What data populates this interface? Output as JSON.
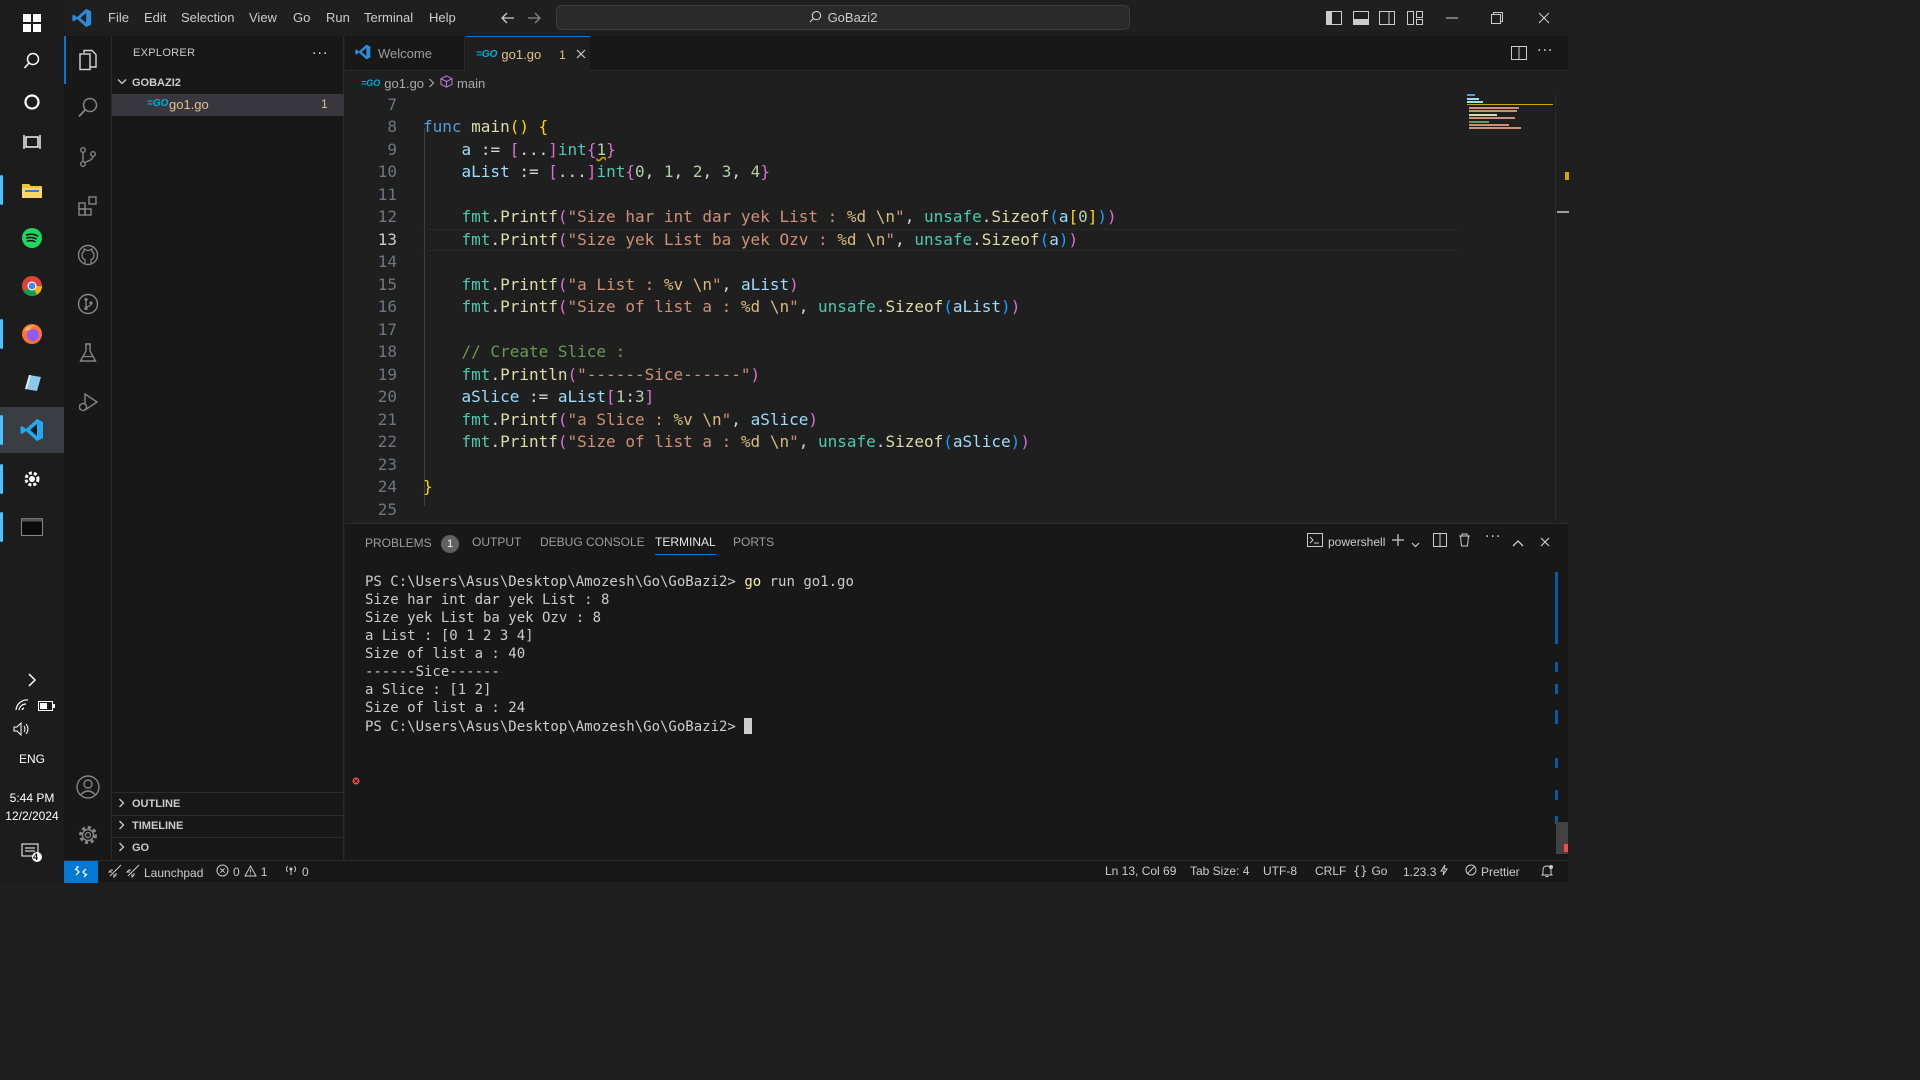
{
  "taskbar": {
    "time": "5:44 PM",
    "date": "12/2/2024",
    "language": "ENG",
    "notification_count": "4"
  },
  "titlebar": {
    "menu": [
      "File",
      "Edit",
      "Selection",
      "View",
      "Go",
      "Run",
      "Terminal",
      "Help"
    ],
    "search_text": "GoBazi2"
  },
  "sidebar": {
    "header": "EXPLORER",
    "folder": "GOBAZI2",
    "file": "go1.go",
    "file_badge": "1",
    "sections": [
      "OUTLINE",
      "TIMELINE",
      "GO"
    ]
  },
  "editor": {
    "tabs": [
      {
        "label": "Welcome"
      },
      {
        "label": "go1.go",
        "badge": "1"
      }
    ],
    "breadcrumb": {
      "file": "go1.go",
      "symbol": "main"
    },
    "line_numbers": [
      "7",
      "8",
      "9",
      "10",
      "11",
      "12",
      "13",
      "14",
      "15",
      "16",
      "17",
      "18",
      "19",
      "20",
      "21",
      "22",
      "23",
      "24",
      "25"
    ],
    "current_line": "13"
  },
  "panel": {
    "tabs": [
      "PROBLEMS",
      "OUTPUT",
      "DEBUG CONSOLE",
      "TERMINAL",
      "PORTS"
    ],
    "problems_count": "1",
    "active_tab": "TERMINAL",
    "shell": "powershell",
    "terminal": {
      "prompt": "PS C:\\Users\\Asus\\Desktop\\Amozesh\\Go\\GoBazi2>",
      "command_go": "go",
      "command_rest": " run go1.go",
      "output": [
        "Size har int dar yek List : 8",
        "Size yek List ba yek Ozv : 8",
        "a List : [0 1 2 3 4]",
        "Size of list a : 40",
        "------Sice------",
        "a Slice : [1 2]",
        "Size of list a : 24"
      ]
    }
  },
  "statusbar": {
    "launchpad": "Launchpad",
    "errors": "0",
    "warnings": "1",
    "ports": "0",
    "position": "Ln 13, Col 69",
    "tab_size": "Tab Size: 4",
    "encoding": "UTF-8",
    "eol": "CRLF",
    "language": "Go",
    "go_version": "1.23.3",
    "formatter": "Prettier"
  },
  "colors": {
    "accent": "#0078d4",
    "keyword": "#569cd6",
    "function": "#dcdcaa",
    "string": "#ce9178",
    "variable": "#9cdcfe",
    "type": "#4ec9b0",
    "comment": "#6a9955",
    "modified_tab": "#e2c08d"
  }
}
